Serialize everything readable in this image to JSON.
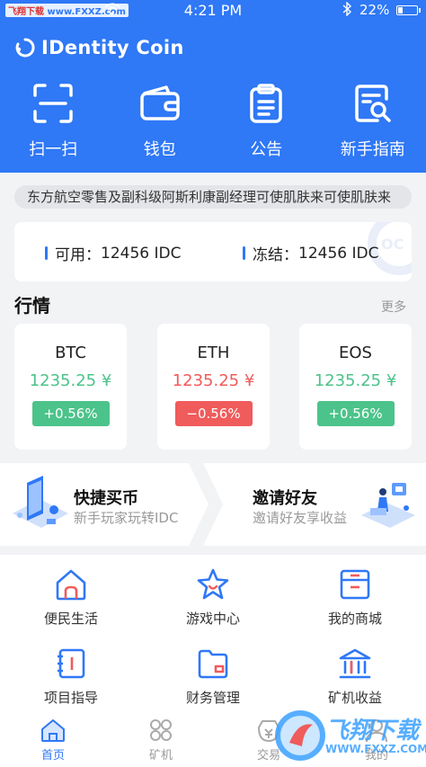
{
  "status_bar": {
    "carrier_text": "飞翔下载",
    "carrier_url": "www.FXXZ.com",
    "time": "4:21 PM",
    "battery_text": "22%",
    "battery_level": 0.22
  },
  "header": {
    "app_name": "IDentity Coin"
  },
  "quick_actions": [
    {
      "label": "扫一扫",
      "icon": "scan-icon"
    },
    {
      "label": "钱包",
      "icon": "wallet-icon"
    },
    {
      "label": "公告",
      "icon": "clipboard-icon"
    },
    {
      "label": "新手指南",
      "icon": "guide-search-icon"
    }
  ],
  "notice": {
    "text": "东方航空零售及副科级阿斯利康副经理可使肌肤来可使肌肤来"
  },
  "balance": {
    "available_label": "可用：",
    "available_value": "12456 IDC",
    "frozen_label": "冻结：",
    "frozen_value": "12456 IDC"
  },
  "market": {
    "title": "行情",
    "more_label": "更多",
    "coins": [
      {
        "symbol": "BTC",
        "price": "1235.25 ¥",
        "change": "+0.56%",
        "trend": "up"
      },
      {
        "symbol": "ETH",
        "price": "1235.25 ¥",
        "change": "−0.56%",
        "trend": "down"
      },
      {
        "symbol": "EOS",
        "price": "1235.25 ¥",
        "change": "+0.56%",
        "trend": "up"
      }
    ]
  },
  "promo": {
    "buy_title": "快捷买币",
    "buy_sub": "新手玩家玩转IDC",
    "invite_title": "邀请好友",
    "invite_sub": "邀请好友享收益"
  },
  "features": [
    {
      "label": "便民生活",
      "icon": "home-icon"
    },
    {
      "label": "游戏中心",
      "icon": "star-icon"
    },
    {
      "label": "我的商城",
      "icon": "store-icon"
    },
    {
      "label": "项目指导",
      "icon": "notebook-icon"
    },
    {
      "label": "财务管理",
      "icon": "folder-icon"
    },
    {
      "label": "矿机收益",
      "icon": "bank-icon"
    }
  ],
  "tabbar": [
    {
      "label": "首页",
      "icon": "home-tab-icon",
      "active": true
    },
    {
      "label": "矿机",
      "icon": "grid-tab-icon",
      "active": false
    },
    {
      "label": "交易",
      "icon": "trade-tab-icon",
      "active": false
    },
    {
      "label": "我的",
      "icon": "profile-tab-icon",
      "active": false
    }
  ],
  "watermark": {
    "text": "飞翔下载",
    "url": "WWW.FXXZ.COM"
  },
  "colors": {
    "brand_blue": "#2f78f6",
    "up_green": "#4cc38a",
    "down_red": "#f05b5b"
  }
}
